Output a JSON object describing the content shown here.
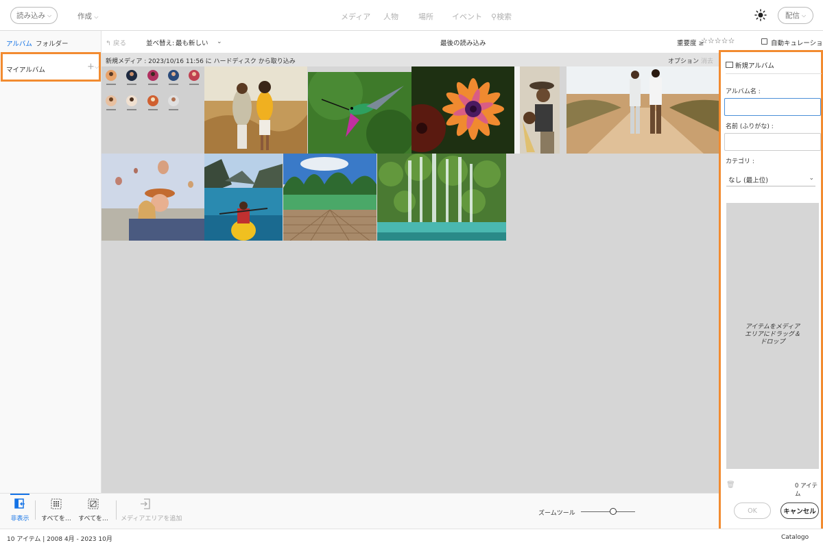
{
  "topbar": {
    "import_label": "読み込み",
    "create_label": "作成",
    "nav": [
      "メディア",
      "人物",
      "場所",
      "イベント"
    ],
    "search_label": "検索",
    "share_label": "配信"
  },
  "left_panel": {
    "tabs": [
      "アルバム",
      "フォルダー"
    ],
    "my_albums_label": "マイアルバム",
    "add_symbol": "+"
  },
  "toolbar": {
    "back_label": "戻る",
    "sort_label": "並べ替え:",
    "sort_value": "最も新しい",
    "view_title": "最後の読み込み",
    "rating_label": "重要度 ≥",
    "rating_stars": "☆☆☆☆☆",
    "auto_curate_label": "自動キュレーション"
  },
  "media": {
    "header_text": "新規メディア : 2023/10/16 11:56 に ハードディスク から取り込み",
    "options_label": "オプション",
    "erase_label": "消去",
    "thumbnails": [
      "people-grid",
      "couple-field",
      "hummingbird",
      "flower",
      "couple-close",
      "couple-road",
      "balloons-selfie",
      "kayak-fjord",
      "dock-lake",
      "waterfall"
    ]
  },
  "new_album_panel": {
    "title": "新規アルバム",
    "album_name_label": "アルバム名 :",
    "furigana_label": "名前 (ふりがな) :",
    "category_label": "カテゴリ :",
    "category_value": "なし (最上位)",
    "drop_text_lines": [
      "アイテムをメディア",
      "エリアにドラッグ＆",
      "ドロップ"
    ],
    "item_count": "0 アイテム",
    "ok_label": "OK",
    "cancel_label": "キャンセル"
  },
  "bottom_toolbar": {
    "hide_label": "非表示",
    "select_all_label": "すべてを…",
    "deselect_all_label": "すべてを…",
    "add_media_label": "メディアエリアを追加",
    "zoom_label": "ズームツール",
    "zoom_level": 0.6
  },
  "status": {
    "left": "10 アイテム | 2008 4月 - 2023 10月",
    "right": "Catalogo"
  },
  "colors": {
    "accent": "#1473e6",
    "highlight": "#f28b30",
    "media_bg": "#d6d6d6"
  }
}
